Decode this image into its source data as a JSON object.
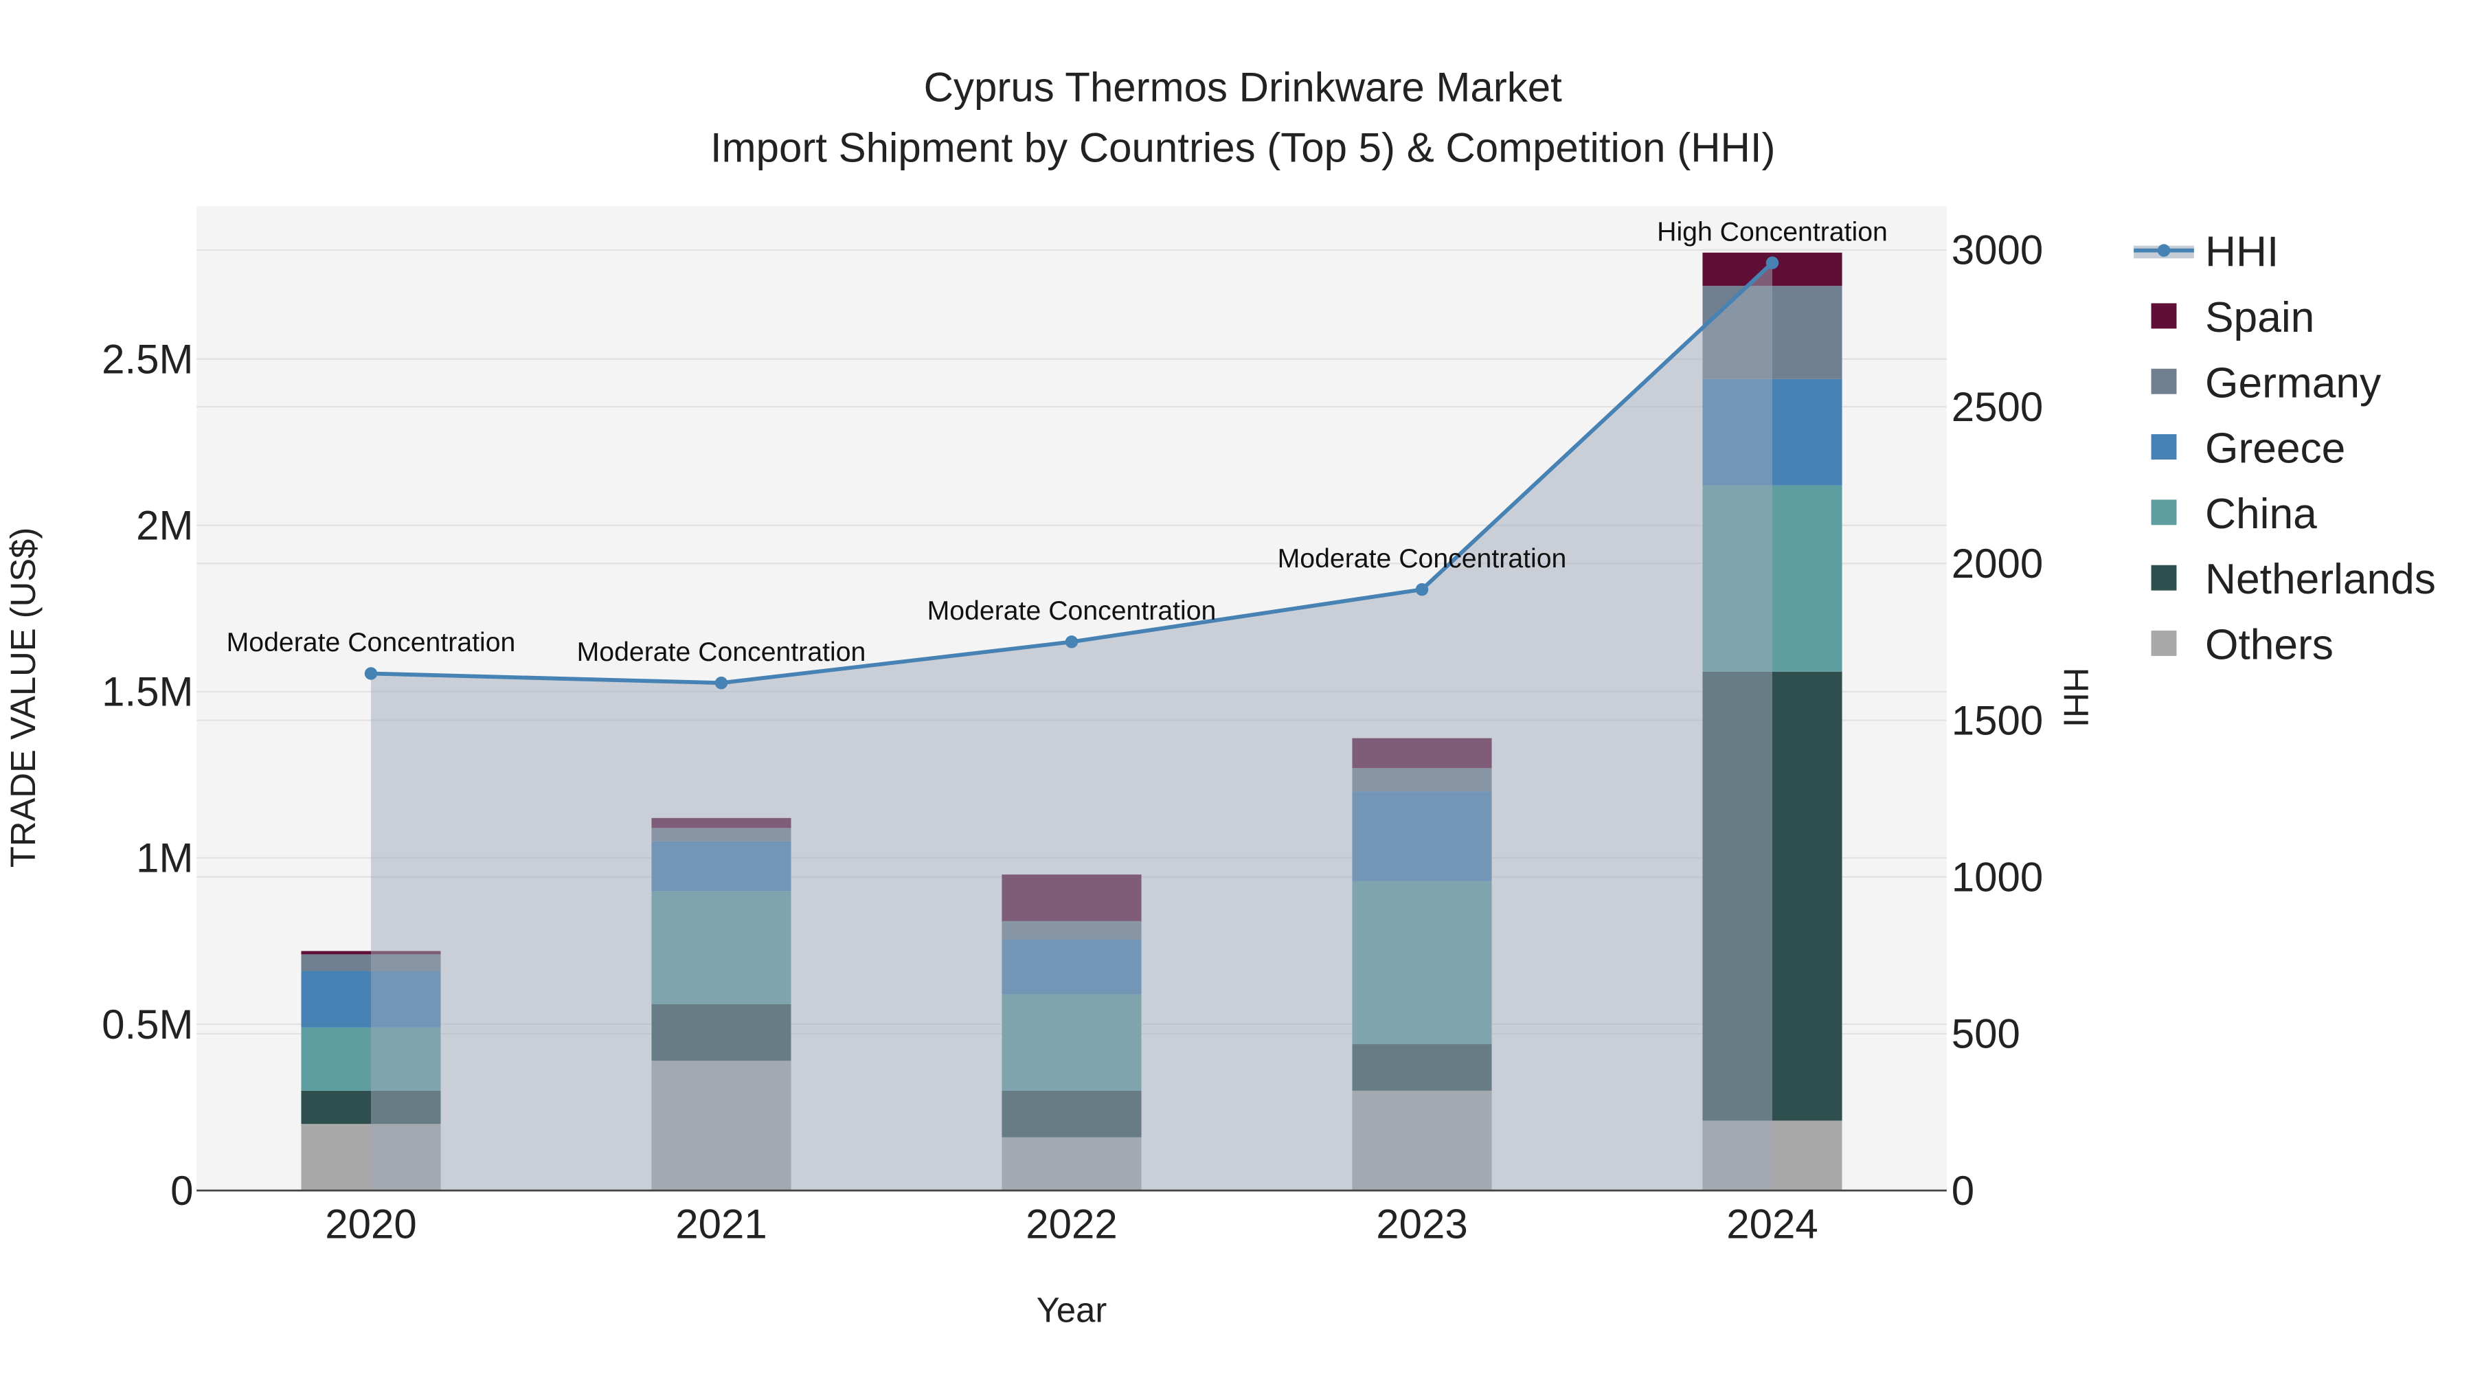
{
  "chart_data": {
    "type": "bar",
    "title": "Cyprus Thermos Drinkware Market",
    "subtitle": "Import Shipment by Countries (Top 5) & Competition (HHI)",
    "xlabel": "Year",
    "ylabel": "TRADE VALUE (US$)",
    "y2label": "HHI",
    "categories": [
      "2020",
      "2021",
      "2022",
      "2023",
      "2024"
    ],
    "ylim": [
      0,
      2960000
    ],
    "y2lim": [
      0,
      3140
    ],
    "yticks": [
      {
        "v": 0,
        "label": "0"
      },
      {
        "v": 500000,
        "label": "0.5M"
      },
      {
        "v": 1000000,
        "label": "1M"
      },
      {
        "v": 1500000,
        "label": "1.5M"
      },
      {
        "v": 2000000,
        "label": "2M"
      },
      {
        "v": 2500000,
        "label": "2.5M"
      }
    ],
    "y2ticks": [
      {
        "v": 0,
        "label": "0"
      },
      {
        "v": 500,
        "label": "500"
      },
      {
        "v": 1000,
        "label": "1000"
      },
      {
        "v": 1500,
        "label": "1500"
      },
      {
        "v": 2000,
        "label": "2000"
      },
      {
        "v": 2500,
        "label": "2500"
      },
      {
        "v": 3000,
        "label": "3000"
      }
    ],
    "series": [
      {
        "name": "Others",
        "color": "#a9a9a9",
        "values": [
          200000,
          390000,
          160000,
          300000,
          210000
        ]
      },
      {
        "name": "Netherlands",
        "color": "#2f4f4f",
        "values": [
          100000,
          170000,
          140000,
          140000,
          1350000
        ]
      },
      {
        "name": "China",
        "color": "#5f9ea0",
        "values": [
          190000,
          340000,
          290000,
          490000,
          560000
        ]
      },
      {
        "name": "Greece",
        "color": "#4682b4",
        "values": [
          170000,
          150000,
          165000,
          270000,
          320000
        ]
      },
      {
        "name": "Germany",
        "color": "#708090",
        "values": [
          50000,
          40000,
          55000,
          70000,
          280000
        ]
      },
      {
        "name": "Spain",
        "color": "#5f0f36",
        "values": [
          10000,
          30000,
          140000,
          90000,
          100000
        ]
      }
    ],
    "hhi": {
      "name": "HHI",
      "color": "#4682b4",
      "values": [
        1649,
        1619,
        1750,
        1917,
        2959
      ],
      "annotations": [
        "Moderate Concentration",
        "Moderate Concentration",
        "Moderate Concentration",
        "Moderate Concentration",
        "High Concentration"
      ]
    },
    "legend": [
      "HHI",
      "Spain",
      "Germany",
      "Greece",
      "China",
      "Netherlands",
      "Others"
    ],
    "legend_placement": "right",
    "grid": true
  }
}
